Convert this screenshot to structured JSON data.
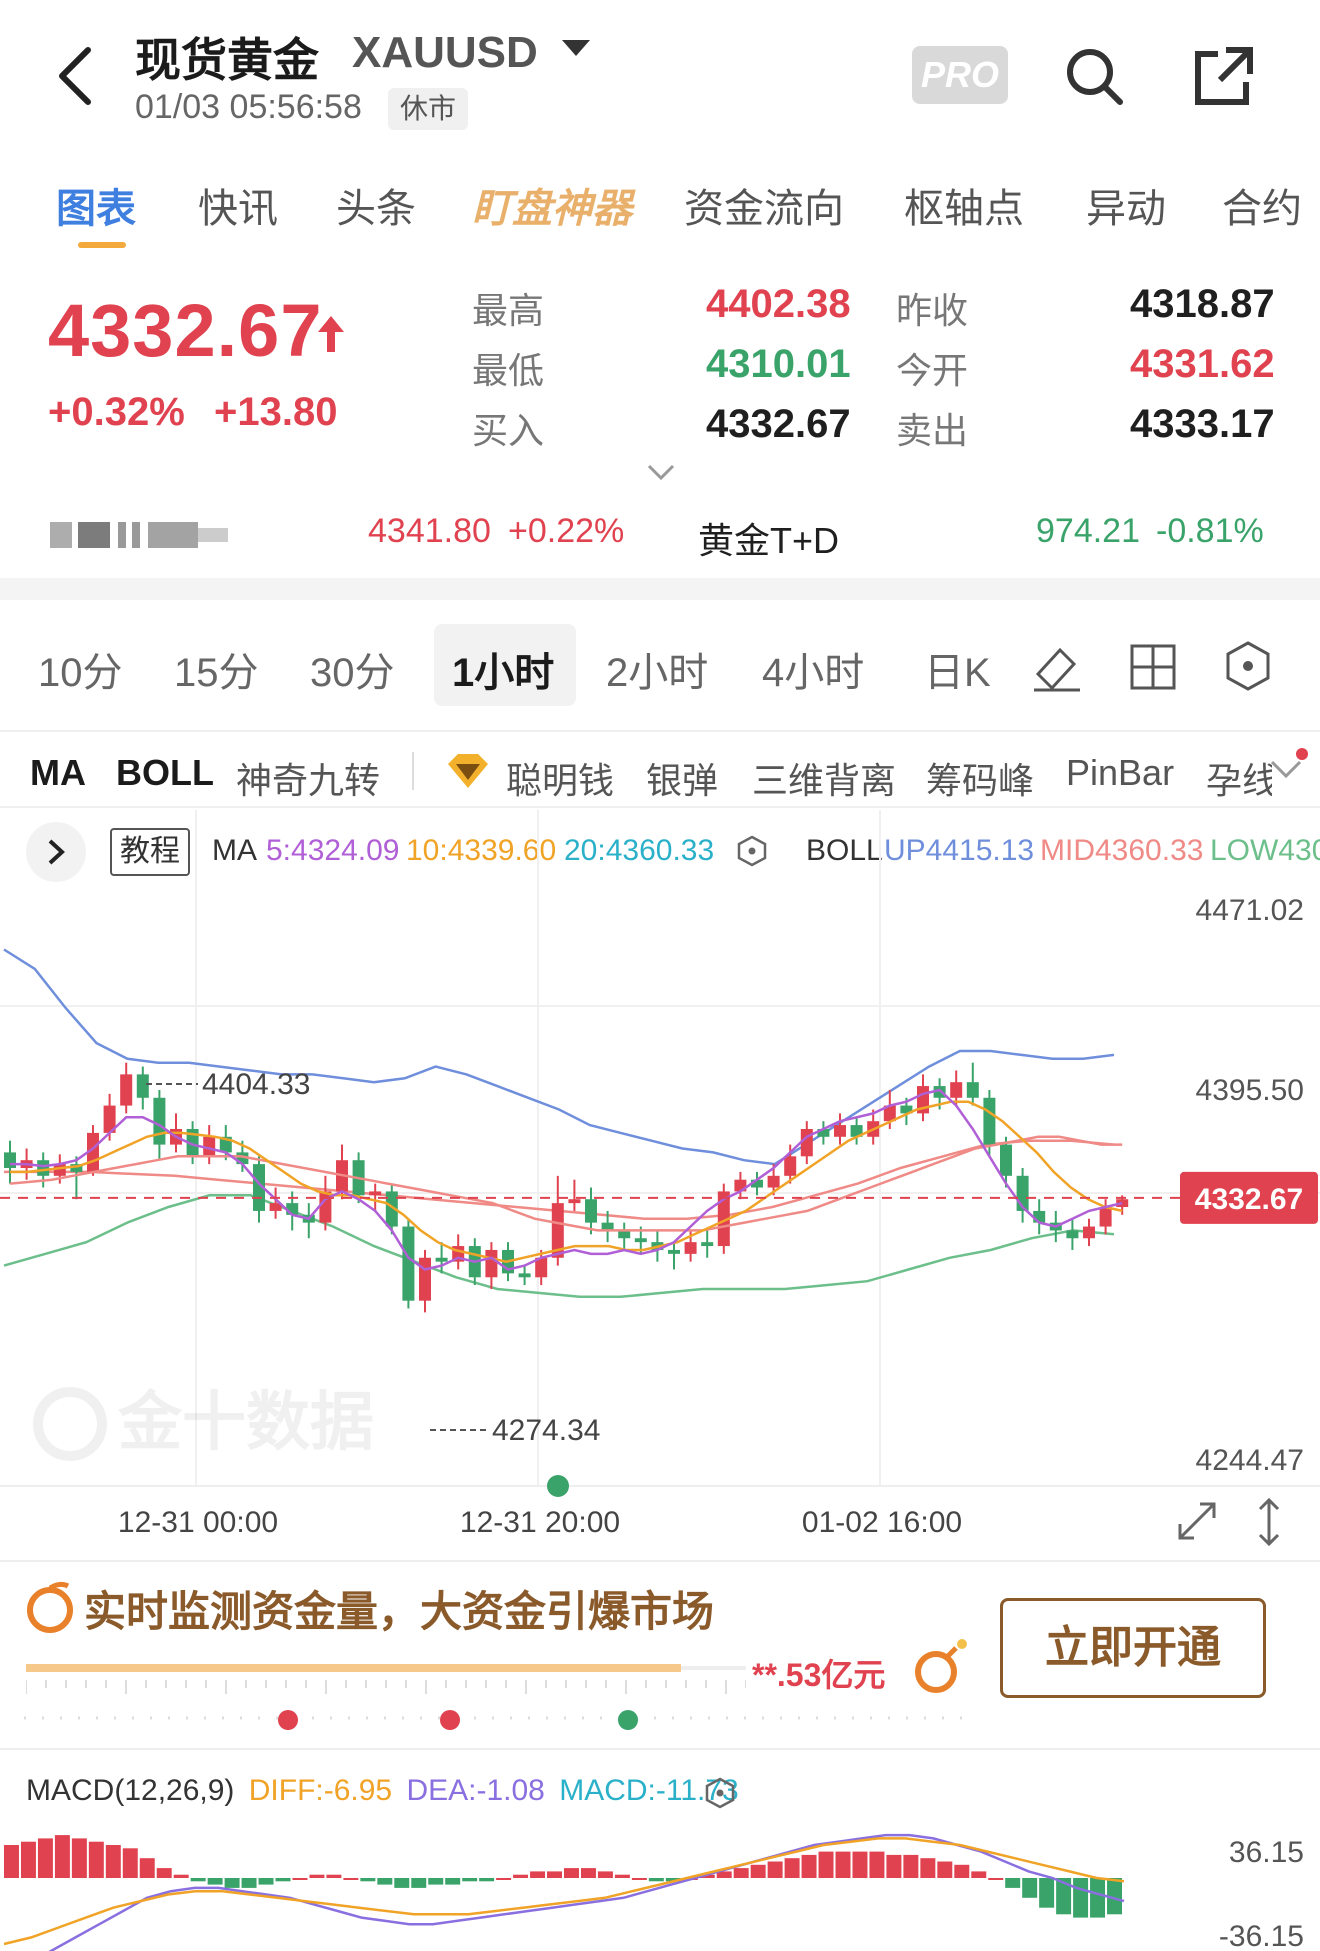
{
  "header": {
    "title": "现货黄金",
    "symbol": "XAUUSD",
    "datetime": "01/03 05:56:58",
    "market_status": "休市",
    "pro_label": "PRO"
  },
  "tabs": [
    "图表",
    "快讯",
    "头条",
    "盯盘神器",
    "资金流向",
    "枢轴点",
    "异动",
    "合约"
  ],
  "quote": {
    "last": "4332.67",
    "change_pct": "+0.32%",
    "change": "+13.80",
    "high_label": "最高",
    "high": "4402.38",
    "low_label": "最低",
    "low": "4310.01",
    "bid_label": "买入",
    "bid": "4332.67",
    "prev_close_label": "昨收",
    "prev_close": "4318.87",
    "open_label": "今开",
    "open": "4331.62",
    "ask_label": "卖出",
    "ask": "4333.17"
  },
  "compare": {
    "item1_value": "4341.80",
    "item1_change": "+0.22%",
    "item2_name": "黄金T+D",
    "item2_value": "974.21",
    "item2_change": "-0.81%"
  },
  "periods": [
    "10分",
    "15分",
    "30分",
    "1小时",
    "2小时",
    "4小时",
    "日K"
  ],
  "indicators": [
    "MA",
    "BOLL",
    "神奇九转",
    "聪明钱",
    "银弹",
    "三维背离",
    "筹码峰",
    "PinBar",
    "孕线"
  ],
  "chart_header": {
    "tutorial": "教程",
    "ma_label": "MA",
    "ma5": "5:4324.09",
    "ma10": "10:4339.60",
    "ma20": "20:4360.33",
    "boll_label": "BOLL",
    "boll_up": "UP4415.13",
    "boll_mid": "MID4360.33",
    "boll_low": "LOW430"
  },
  "colors": {
    "up": "#e0424f",
    "down": "#3aa36a",
    "ma5": "#b05fd6",
    "ma10": "#f0a326",
    "ma20": "#2ab0c9",
    "boll_up": "#6f8fdc",
    "boll_mid": "#ef8a86",
    "boll_low": "#6cbf8a",
    "accent": "#3f7fe0",
    "gold": "#f3a93b"
  },
  "chart_data": {
    "type": "candlestick",
    "price_axis_labels": [
      "4471.02",
      "4395.50",
      "4332.67",
      "4244.47"
    ],
    "ylim": [
      4244.47,
      4471.02
    ],
    "time_labels": [
      "12-31 00:00",
      "12-31 20:00",
      "01-02 16:00"
    ],
    "annotations": {
      "high_mark": "4404.33",
      "low_mark": "4274.34",
      "last_price": "4332.67"
    },
    "candles": [
      [
        4356,
        4348,
        4362,
        4340
      ],
      [
        4348,
        4352,
        4358,
        4342
      ],
      [
        4352,
        4344,
        4356,
        4338
      ],
      [
        4344,
        4350,
        4355,
        4340
      ],
      [
        4350,
        4346,
        4354,
        4332
      ],
      [
        4346,
        4366,
        4370,
        4344
      ],
      [
        4366,
        4380,
        4386,
        4362
      ],
      [
        4380,
        4396,
        4402,
        4376
      ],
      [
        4396,
        4384,
        4400,
        4378
      ],
      [
        4384,
        4360,
        4388,
        4352
      ],
      [
        4360,
        4368,
        4376,
        4356
      ],
      [
        4368,
        4354,
        4372,
        4350
      ],
      [
        4354,
        4364,
        4370,
        4350
      ],
      [
        4364,
        4356,
        4370,
        4352
      ],
      [
        4356,
        4350,
        4362,
        4346
      ],
      [
        4350,
        4326,
        4354,
        4320
      ],
      [
        4326,
        4330,
        4338,
        4322
      ],
      [
        4330,
        4324,
        4336,
        4316
      ],
      [
        4324,
        4320,
        4330,
        4312
      ],
      [
        4320,
        4336,
        4344,
        4316
      ],
      [
        4336,
        4352,
        4360,
        4332
      ],
      [
        4352,
        4334,
        4356,
        4330
      ],
      [
        4334,
        4336,
        4340,
        4326
      ],
      [
        4336,
        4318,
        4340,
        4314
      ],
      [
        4318,
        4280,
        4322,
        4276
      ],
      [
        4280,
        4302,
        4306,
        4274
      ],
      [
        4302,
        4300,
        4310,
        4294
      ],
      [
        4300,
        4308,
        4314,
        4296
      ],
      [
        4308,
        4292,
        4312,
        4288
      ],
      [
        4292,
        4306,
        4310,
        4286
      ],
      [
        4306,
        4294,
        4310,
        4290
      ],
      [
        4294,
        4292,
        4298,
        4288
      ],
      [
        4292,
        4302,
        4306,
        4288
      ],
      [
        4302,
        4330,
        4344,
        4298
      ],
      [
        4330,
        4332,
        4342,
        4326
      ],
      [
        4332,
        4320,
        4338,
        4314
      ],
      [
        4320,
        4316,
        4326,
        4310
      ],
      [
        4316,
        4312,
        4320,
        4306
      ],
      [
        4312,
        4310,
        4318,
        4304
      ],
      [
        4310,
        4306,
        4316,
        4300
      ],
      [
        4306,
        4304,
        4310,
        4296
      ],
      [
        4304,
        4310,
        4316,
        4300
      ],
      [
        4310,
        4308,
        4316,
        4302
      ],
      [
        4308,
        4336,
        4340,
        4304
      ],
      [
        4336,
        4342,
        4346,
        4332
      ],
      [
        4342,
        4338,
        4346,
        4334
      ],
      [
        4338,
        4344,
        4350,
        4334
      ],
      [
        4344,
        4354,
        4360,
        4340
      ],
      [
        4354,
        4368,
        4372,
        4350
      ],
      [
        4368,
        4364,
        4372,
        4360
      ],
      [
        4364,
        4370,
        4376,
        4360
      ],
      [
        4370,
        4364,
        4374,
        4360
      ],
      [
        4364,
        4372,
        4378,
        4360
      ],
      [
        4372,
        4380,
        4388,
        4368
      ],
      [
        4380,
        4376,
        4384,
        4370
      ],
      [
        4376,
        4390,
        4396,
        4372
      ],
      [
        4390,
        4384,
        4394,
        4378
      ],
      [
        4384,
        4392,
        4398,
        4380
      ],
      [
        4392,
        4384,
        4402,
        4380
      ],
      [
        4384,
        4360,
        4388,
        4354
      ],
      [
        4360,
        4344,
        4364,
        4338
      ],
      [
        4344,
        4326,
        4348,
        4320
      ],
      [
        4326,
        4320,
        4332,
        4314
      ],
      [
        4320,
        4316,
        4326,
        4310
      ],
      [
        4316,
        4312,
        4322,
        4306
      ],
      [
        4312,
        4318,
        4322,
        4308
      ],
      [
        4318,
        4328,
        4332,
        4314
      ],
      [
        4328,
        4332,
        4334,
        4324
      ]
    ],
    "ma5": [
      4350,
      4350,
      4349,
      4350,
      4352,
      4358,
      4366,
      4374,
      4374,
      4370,
      4364,
      4360,
      4358,
      4356,
      4350,
      4340,
      4332,
      4324,
      4322,
      4332,
      4336,
      4332,
      4326,
      4316,
      4302,
      4296,
      4298,
      4302,
      4300,
      4302,
      4296,
      4298,
      4302,
      4304,
      4306,
      4304,
      4304,
      4306,
      4304,
      4306,
      4310,
      4318,
      4326,
      4332,
      4336,
      4342,
      4348,
      4356,
      4364,
      4368,
      4372,
      4374,
      4376,
      4380,
      4382,
      4386,
      4388,
      4380,
      4368,
      4354,
      4340,
      4328,
      4320,
      4318,
      4322,
      4326,
      4328,
      4330
    ],
    "ma10": [
      4346,
      4346,
      4347,
      4348,
      4349,
      4352,
      4356,
      4360,
      4364,
      4366,
      4366,
      4365,
      4364,
      4362,
      4358,
      4352,
      4346,
      4340,
      4336,
      4334,
      4334,
      4332,
      4330,
      4324,
      4316,
      4310,
      4306,
      4304,
      4302,
      4300,
      4302,
      4304,
      4306,
      4308,
      4308,
      4308,
      4306,
      4306,
      4308,
      4310,
      4314,
      4318,
      4322,
      4326,
      4332,
      4338,
      4344,
      4350,
      4356,
      4362,
      4366,
      4370,
      4374,
      4378,
      4380,
      4382,
      4382,
      4378,
      4372,
      4364,
      4356,
      4346,
      4338,
      4332,
      4328,
      4326
    ],
    "ma20": [
      4340,
      4341,
      4342,
      4344,
      4346,
      4348,
      4350,
      4352,
      4354,
      4354,
      4354,
      4354,
      4352,
      4350,
      4348,
      4346,
      4344,
      4342,
      4340,
      4338,
      4336,
      4334,
      4332,
      4330,
      4326,
      4322,
      4320,
      4318,
      4316,
      4316,
      4316,
      4316,
      4316,
      4316,
      4318,
      4320,
      4322,
      4324,
      4326,
      4330,
      4334,
      4338,
      4342,
      4346,
      4350,
      4354,
      4358,
      4360,
      4362,
      4364,
      4364,
      4362,
      4360,
      4360
    ],
    "boll_up": [
      4460,
      4450,
      4430,
      4412,
      4404,
      4402,
      4402,
      4400,
      4398,
      4396,
      4396,
      4394,
      4392,
      4394,
      4400,
      4396,
      4390,
      4384,
      4378,
      4370,
      4366,
      4362,
      4358,
      4356,
      4352,
      4350,
      4360,
      4370,
      4380,
      4390,
      4400,
      4408,
      4408,
      4406,
      4404,
      4404,
      4406
    ],
    "boll_mid": [
      4346,
      4346,
      4346,
      4345,
      4344,
      4342,
      4340,
      4338,
      4336,
      4334,
      4332,
      4330,
      4328,
      4326,
      4324,
      4322,
      4322,
      4324,
      4328,
      4334,
      4340,
      4348,
      4354,
      4360,
      4362,
      4362,
      4360
    ],
    "boll_low": [
      4298,
      4304,
      4310,
      4320,
      4328,
      4334,
      4334,
      4326,
      4318,
      4308,
      4300,
      4292,
      4286,
      4284,
      4282,
      4282,
      4284,
      4286,
      4286,
      4286,
      4288,
      4290,
      4296,
      4302,
      4306,
      4312,
      4316,
      4314
    ]
  },
  "promo": {
    "title": "实时监测资金量，大资金引爆市场",
    "amount": "**.53亿元",
    "button": "立即开通"
  },
  "macd": {
    "label": "MACD(12,26,9)",
    "diff": "DIFF:-6.95",
    "dea": "DEA:-1.08",
    "macd": "MACD:-11.73",
    "axis_top": "36.15",
    "axis_bottom": "-36.15",
    "hist": [
      10,
      11,
      12,
      13,
      12,
      11,
      10,
      9,
      6,
      3,
      1,
      -1,
      -2,
      -3,
      -3,
      -2,
      -1,
      0,
      1,
      1,
      0,
      -1,
      -2,
      -3,
      -3,
      -2,
      -2,
      -1,
      -1,
      0,
      1,
      2,
      2,
      3,
      3,
      2,
      1,
      0,
      -1,
      -1,
      0,
      1,
      2,
      3,
      4,
      5,
      6,
      7,
      8,
      8,
      8,
      8,
      7,
      7,
      6,
      5,
      4,
      2,
      0,
      -3,
      -6,
      -9,
      -11,
      -12,
      -12,
      -11
    ],
    "diff_line": [
      -30,
      -26,
      -22,
      -18,
      -14,
      -10,
      -6,
      -4,
      -3,
      -3,
      -4,
      -5,
      -6,
      -8,
      -10,
      -12,
      -13,
      -14,
      -14,
      -13,
      -12,
      -11,
      -10,
      -9,
      -8,
      -7,
      -6,
      -4,
      -2,
      0,
      2,
      4,
      6,
      8,
      10,
      11,
      12,
      13,
      13,
      12,
      10,
      8,
      5,
      2,
      0,
      -3,
      -5,
      -7
    ],
    "dea_line": [
      -20,
      -18,
      -15,
      -12,
      -9,
      -7,
      -5,
      -4,
      -4,
      -5,
      -6,
      -7,
      -8,
      -9,
      -10,
      -11,
      -11,
      -11,
      -10,
      -9,
      -8,
      -7,
      -6,
      -4,
      -2,
      0,
      2,
      4,
      6,
      8,
      10,
      11,
      12,
      12,
      11,
      10,
      8,
      6,
      4,
      2,
      0,
      -1
    ]
  }
}
